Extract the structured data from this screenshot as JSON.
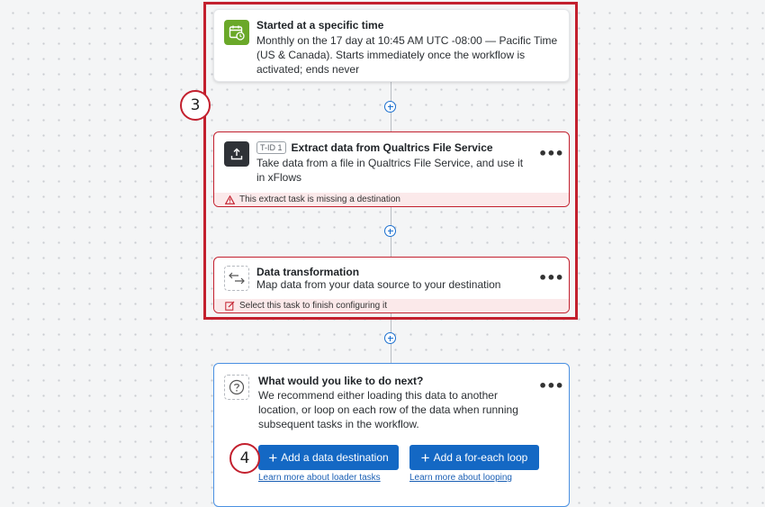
{
  "trigger": {
    "title": "Started at a specific time",
    "description": "Monthly on the 17 day at 10:45 AM UTC -08:00 — Pacific Time (US & Canada). Starts immediately once the workflow is activated; ends never",
    "icon": "calendar-clock-icon"
  },
  "step_badges": {
    "three": "3",
    "four": "4"
  },
  "extract_task": {
    "tag": "T-ID 1",
    "title": "Extract data from Qualtrics File Service",
    "description": "Take data from a file in Qualtrics File Service, and use it in xFlows",
    "warning": "This extract task is missing a destination",
    "icon": "upload-icon",
    "menu": "•••"
  },
  "transform_task": {
    "title": "Data transformation",
    "description": "Map data from your data source to your destination",
    "warning": "Select this task to finish configuring it",
    "icon": "arrows-left-right-icon",
    "menu": "•••"
  },
  "next_step": {
    "title": "What would you like to do next?",
    "description": "We recommend either loading this data to another location, or loop on each row of the data when running subsequent tasks in the workflow.",
    "icon": "question-icon",
    "menu": "•••",
    "buttons": [
      {
        "label": "Add a data destination",
        "link": "Learn more about loader tasks"
      },
      {
        "label": "Add a for-each loop",
        "link": "Learn more about looping"
      }
    ]
  },
  "colors": {
    "accent_blue": "#1468c4",
    "highlight_red": "#c3202e",
    "trigger_green": "#6aa829",
    "warning_bg": "#fbe9ea"
  }
}
